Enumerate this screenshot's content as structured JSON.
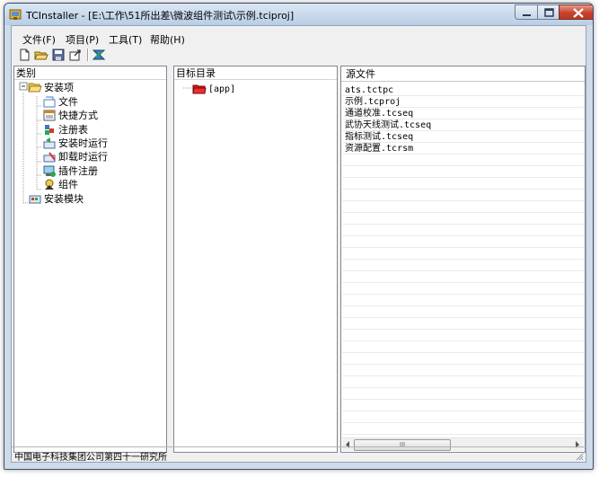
{
  "window": {
    "title": "TCInstaller - [E:\\工作\\51所出差\\微波组件测试\\示例.tciproj]"
  },
  "menu": [
    {
      "label": "文件(F)"
    },
    {
      "label": "项目(P)"
    },
    {
      "label": "工具(T)"
    },
    {
      "label": "帮助(H)"
    }
  ],
  "toolbar": {
    "buttons": [
      "new-icon",
      "open-icon",
      "save-icon",
      "export-icon",
      "build-icon"
    ]
  },
  "category_pane": {
    "header": "类别",
    "tree": [
      {
        "label": "安装项",
        "icon": "folder-open-icon",
        "level": 0,
        "expander": "minus"
      },
      {
        "label": "文件",
        "icon": "file-icon",
        "level": 1
      },
      {
        "label": "快捷方式",
        "icon": "shortcut-icon",
        "level": 1
      },
      {
        "label": "注册表",
        "icon": "registry-icon",
        "level": 1
      },
      {
        "label": "安装时运行",
        "icon": "install-run-icon",
        "level": 1
      },
      {
        "label": "卸载时运行",
        "icon": "uninstall-run-icon",
        "level": 1
      },
      {
        "label": "插件注册",
        "icon": "plugin-icon",
        "level": 1
      },
      {
        "label": "组件",
        "icon": "component-icon",
        "level": 1
      },
      {
        "label": "安装模块",
        "icon": "module-icon",
        "level": 0
      }
    ]
  },
  "target_pane": {
    "header": "目标目录",
    "items": [
      {
        "label": "[app]",
        "icon": "red-folder-icon"
      }
    ]
  },
  "source_pane": {
    "header": "源文件",
    "files": [
      "ats.tctpc",
      "示例.tcproj",
      "通道校准.tcseq",
      "武协天线测试.tcseq",
      "指标测试.tcseq",
      "资源配置.tcrsm"
    ],
    "scroll_thumb": "III"
  },
  "status": {
    "text": "中国电子科技集团公司第四十一研究所"
  },
  "colors": {
    "title_bar": "#c9d9ec",
    "close_button": "#c8412c",
    "client_bg": "#f0f0f0"
  }
}
